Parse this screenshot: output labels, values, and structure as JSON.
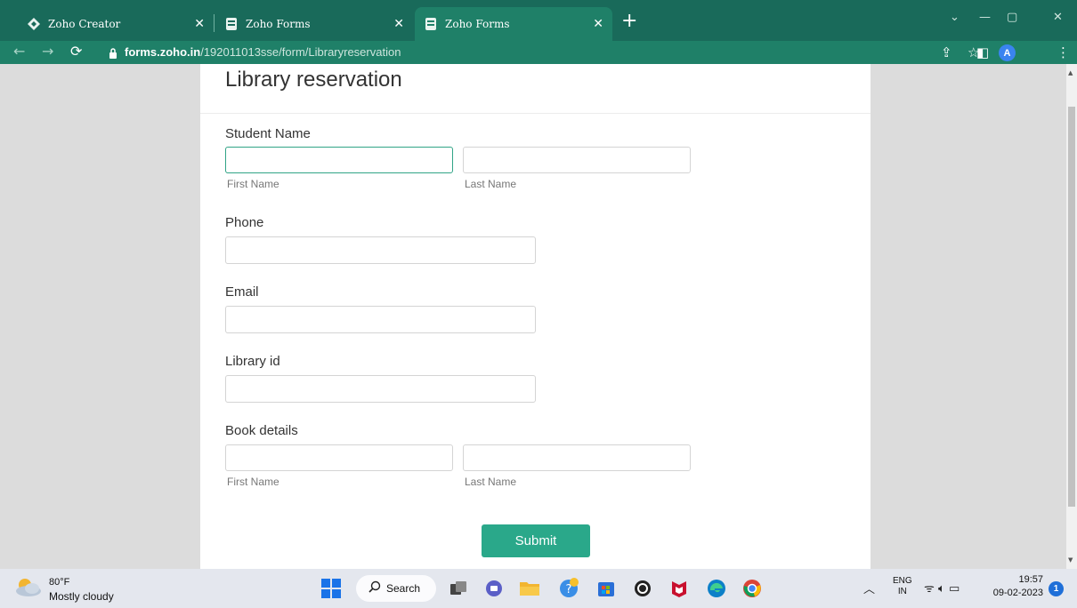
{
  "browser": {
    "tabs": [
      {
        "title": "Zoho Creator",
        "icon": "zoho-creator-icon",
        "active": false
      },
      {
        "title": "Zoho Forms",
        "icon": "zoho-forms-icon",
        "active": false
      },
      {
        "title": "Zoho Forms",
        "icon": "zoho-forms-icon",
        "active": true
      }
    ],
    "new_tab_label": "+",
    "address": {
      "domain": "forms.zoho.in",
      "path": "/192011013sse/form/Libraryreservation"
    },
    "profile_initial": "A",
    "colors": {
      "tab_strip": "#196a5a",
      "toolbar": "#1f8068"
    }
  },
  "form": {
    "title": "Library reservation",
    "fields": {
      "student_name": {
        "label": "Student Name",
        "first_sub": "First Name",
        "last_sub": "Last Name",
        "first_value": "",
        "last_value": ""
      },
      "phone": {
        "label": "Phone",
        "value": ""
      },
      "email": {
        "label": "Email",
        "value": ""
      },
      "library_id": {
        "label": "Library id",
        "value": ""
      },
      "book_details": {
        "label": "Book details",
        "first_sub": "First Name",
        "last_sub": "Last Name",
        "first_value": "",
        "last_value": ""
      }
    },
    "submit_label": "Submit",
    "accent_color": "#2aa88a"
  },
  "taskbar": {
    "weather": {
      "temp": "80°F",
      "condition": "Mostly cloudy"
    },
    "search_label": "Search",
    "apps": [
      "windows-start-icon",
      "task-view-icon",
      "teams-chat-icon",
      "file-explorer-icon",
      "help-icon",
      "microsoft-store-icon",
      "app-icon",
      "mcafee-icon",
      "edge-icon",
      "chrome-icon"
    ],
    "language": {
      "line1": "ENG",
      "line2": "IN"
    },
    "time": "19:57",
    "date": "09-02-2023",
    "notifications": "1"
  }
}
